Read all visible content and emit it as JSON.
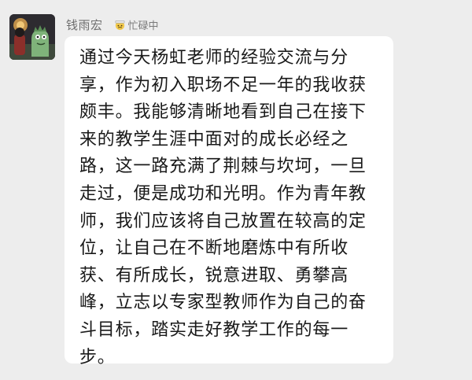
{
  "chat": {
    "sender": {
      "name": "钱雨宏",
      "status_text": "忙碌中",
      "status_icon": "busy-face-icon",
      "avatar_icon": "dinosaur-avatar-icon"
    },
    "message": {
      "text": "通过今天杨虹老师的经验交流与分享，作为初入职场不足一年的我收获颇丰。我能够清晰地看到自己在接下来的教学生涯中面对的成长必经之路，这一路充满了荆棘与坎坷，一旦走过，便是成功和光明。作为青年教师，我们应该将自己放置在较高的定位，让自己在不断地磨炼中有所收获、有所成长，锐意进取、勇攀高峰，立志以专家型教师作为自己的奋斗目标，踏实走好教学工作的每一步。"
    }
  },
  "colors": {
    "background": "#ededed",
    "bubble": "#ffffff",
    "text": "#191919",
    "name": "#6f6f6f"
  }
}
